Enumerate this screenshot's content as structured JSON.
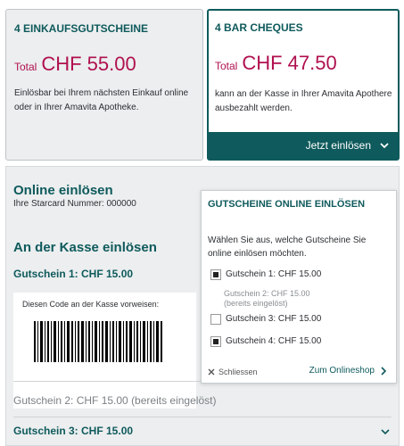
{
  "voucher_card": {
    "title": "4 EINKAUFSGUTSCHEINE",
    "total_label": "Total",
    "total_amount": "CHF 55.00",
    "description": "Einlösbar bei Ihrem nächsten Einkauf online oder in Ihrer Amavita Apotheke."
  },
  "bar_card": {
    "title": "4 BAR CHEQUES",
    "total_label": "Total",
    "total_amount": "CHF 47.50",
    "description": "kann an der Kasse in Ihrer Amavita Apothere ausbezahlt werden.",
    "redeem_label": "Jetzt einlösen",
    "redeem_icon": "chevron-down-icon"
  },
  "main": {
    "online_title": "Online einlösen",
    "starcard": "Ihre Starcard Nummer: 000000",
    "store_title": "An der Kasse einlösen",
    "voucher1_label": "Gutschein 1: CHF 15.00",
    "code_text": "Diesen Code an der Kasse vorweisen:",
    "voucher2_label": "Gutschein 2: CHF 15.00 (bereits eingelöst)",
    "voucher3_label": "Gutschein 3: CHF 15.00"
  },
  "popup": {
    "title": "GUTSCHEINE ONLINE EINLÖSEN",
    "description": "Wählen Sie aus, welche Gutscheine Sie online einlösen möchten.",
    "option1": "Gutschein 1: CHF 15.00",
    "option2_line1": "Gutschein 2: CHF 15.00",
    "option2_line2": "(bereits eingelöst)",
    "option3": "Gutschein 3: CHF 15.00",
    "option4": "Gutschein 4: CHF 15.00",
    "option1_checked": true,
    "option3_checked": false,
    "option4_checked": true,
    "close_label": "Schliessen",
    "shop_label": "Zum Onlineshop"
  },
  "colors": {
    "accent": "#0f5a5c",
    "price": "#b0104f",
    "panel": "#eceeef"
  }
}
